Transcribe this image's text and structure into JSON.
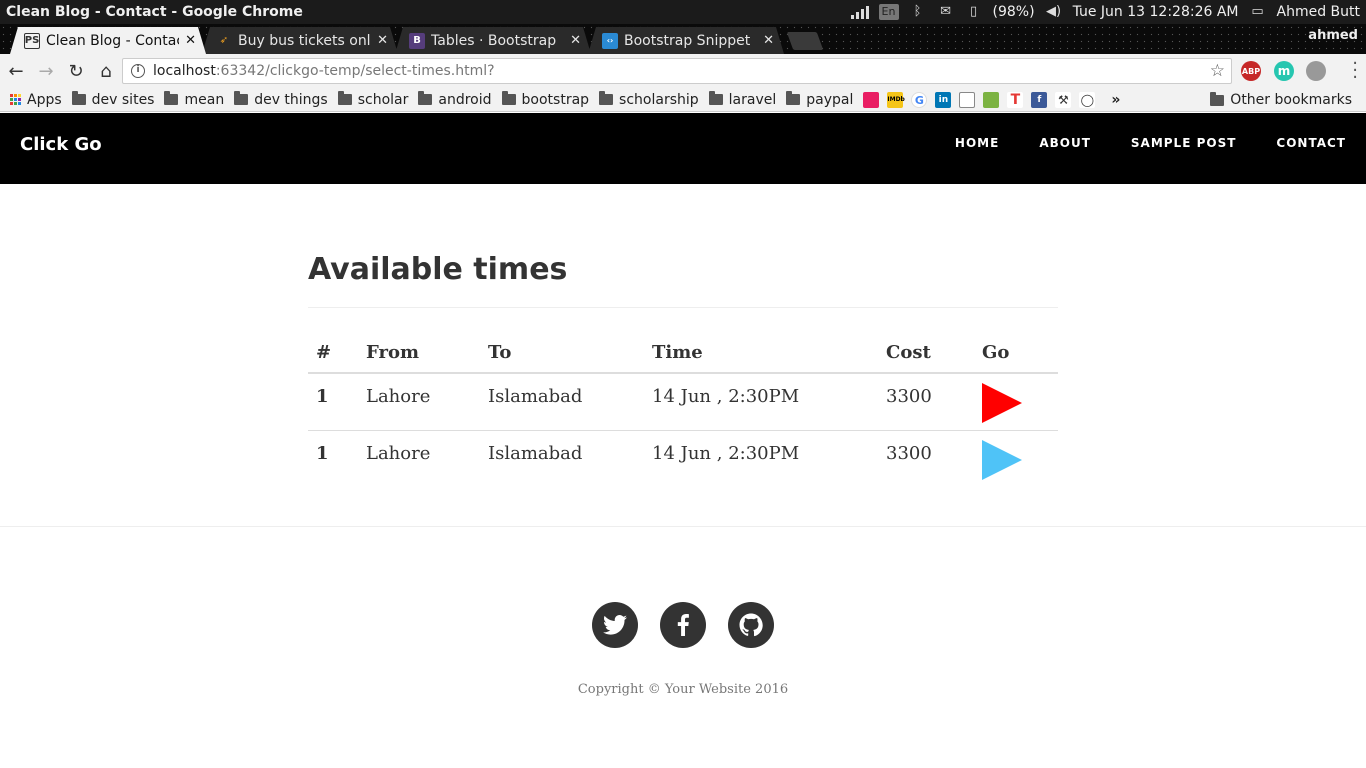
{
  "os": {
    "window_title": "Clean Blog - Contact - Google Chrome",
    "keyboard": "En",
    "battery": "(98%)",
    "datetime": "Tue Jun 13 12:28:26 AM",
    "user": "Ahmed Butt"
  },
  "browser": {
    "profile": "ahmed",
    "tabs": [
      {
        "label": "Clean Blog - Contac",
        "icon": "phpstorm-icon"
      },
      {
        "label": "Buy bus tickets onli",
        "icon": "bus-icon"
      },
      {
        "label": "Tables · Bootstrap",
        "icon": "bootstrap-icon"
      },
      {
        "label": "Bootstrap Snippet",
        "icon": "snippet-icon"
      }
    ],
    "url_host": "localhost",
    "url_rest": ":63342/clickgo-temp/select-times.html?",
    "extensions": [
      "ABP",
      "m"
    ]
  },
  "bookmarks": {
    "apps": "Apps",
    "folders": [
      "dev sites",
      "mean",
      "dev things",
      "scholar",
      "android",
      "bootstrap",
      "scholarship",
      "laravel",
      "paypal"
    ],
    "more": "»",
    "other": "Other bookmarks"
  },
  "site": {
    "brand": "Click Go",
    "nav": [
      "HOME",
      "ABOUT",
      "SAMPLE POST",
      "CONTACT"
    ],
    "heading": "Available times",
    "table": {
      "headers": [
        "#",
        "From",
        "To",
        "Time",
        "Cost",
        "Go"
      ],
      "rows": [
        {
          "num": "1",
          "from": "Lahore",
          "to": "Islamabad",
          "time": "14 Jun , 2:30PM",
          "cost": "3300",
          "go_color": "#ff0000"
        },
        {
          "num": "1",
          "from": "Lahore",
          "to": "Islamabad",
          "time": "14 Jun , 2:30PM",
          "cost": "3300",
          "go_color": "#4fc3f7"
        }
      ]
    },
    "footer": {
      "social": [
        "twitter-icon",
        "facebook-icon",
        "github-icon"
      ],
      "copyright": "Copyright © Your Website 2016"
    }
  }
}
